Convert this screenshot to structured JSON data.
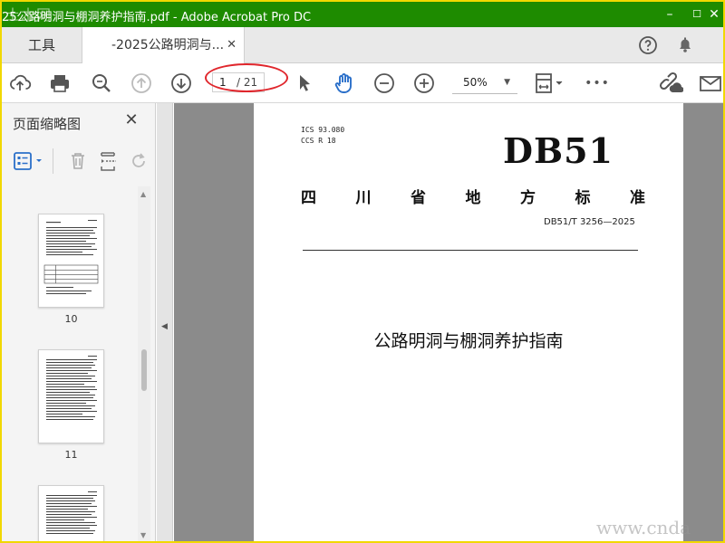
{
  "window": {
    "title": "25公路明洞与棚洞养护指南.pdf - Adobe Acrobat Pro DC",
    "watermark_top": "土木网",
    "minimize": "–",
    "maximize": "☐",
    "close": "✕"
  },
  "tabs": {
    "tools_label": "工具",
    "doc_label": "-2025公路明洞与...",
    "close": "✕"
  },
  "toolbar": {
    "current_page": "1",
    "total_pages": "/ 21",
    "zoom": "50%",
    "zoom_caret": "▼",
    "more": "•••"
  },
  "panel": {
    "title": "页面缩略图",
    "close": "✕",
    "thumbnails": [
      {
        "label": "10"
      },
      {
        "label": "11"
      },
      {
        "label": ""
      }
    ]
  },
  "document": {
    "ics_line1": "ICS 93.080",
    "ics_line2": "CCS R 18",
    "code": "DB51",
    "province_chars": [
      "四",
      "川",
      "省",
      "地",
      "方",
      "标",
      "准"
    ],
    "standard_no": "DB51/T 3256—2025",
    "title": "公路明洞与棚洞养护指南"
  },
  "watermark_bottom": "www.cnda",
  "colors": {
    "titlebar": "#1e8b00",
    "frame": "#f1d800",
    "highlight": "#e0262c",
    "accent_blue": "#2a6fc9"
  }
}
